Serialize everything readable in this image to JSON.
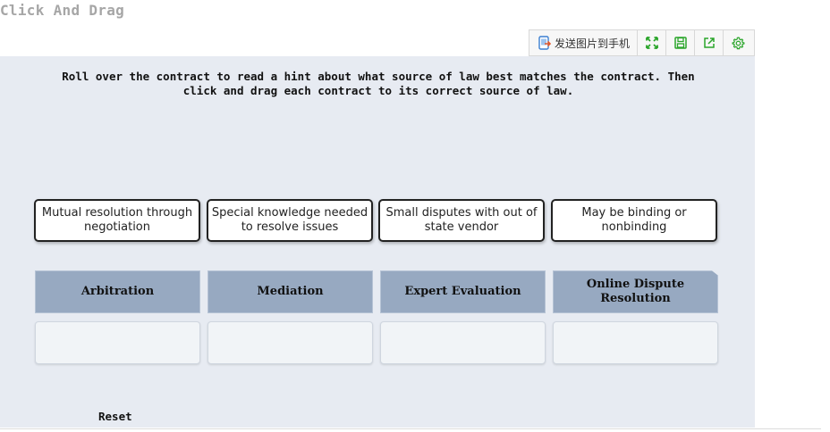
{
  "page": {
    "title": "Click And Drag"
  },
  "toolbar": {
    "send_label": "发送图片到手机",
    "icons": [
      "send-phone-icon",
      "expand-icon",
      "save-icon",
      "share-icon",
      "gear-icon"
    ],
    "accent": "#2aa52a"
  },
  "instructions": "Roll over the contract to read a hint about what source of law best matches the contract. Then click and drag each contract to its correct source of law.",
  "cards": [
    {
      "label": "Mutual resolution through negotiation"
    },
    {
      "label": "Special knowledge needed to resolve issues"
    },
    {
      "label": "Small disputes with out of state vendor"
    },
    {
      "label": "May be binding or nonbinding"
    }
  ],
  "bins": [
    {
      "label": "Arbitration"
    },
    {
      "label": "Mediation"
    },
    {
      "label": "Expert Evaluation"
    },
    {
      "label": "Online Dispute Resolution"
    }
  ],
  "reset_label": "Reset",
  "colors": {
    "stage": "#e7ebf2",
    "bin_header": "#97a9c1",
    "drop_zone": "#f1f4f7"
  }
}
